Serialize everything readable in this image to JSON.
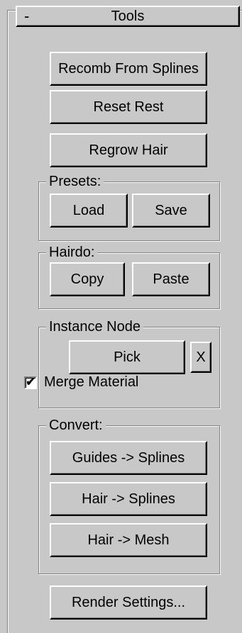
{
  "rollout": {
    "collapse_symbol": "-",
    "title": "Tools"
  },
  "buttons": {
    "recomb": "Recomb From Splines",
    "reset_rest": "Reset Rest",
    "regrow": "Regrow Hair",
    "render_settings": "Render Settings..."
  },
  "presets": {
    "label": "Presets:",
    "load": "Load",
    "save": "Save"
  },
  "hairdo": {
    "label": "Hairdo:",
    "copy": "Copy",
    "paste": "Paste"
  },
  "instance_node": {
    "label": "Instance Node",
    "pick": "Pick",
    "clear": "X",
    "merge_material_label": "Merge Material",
    "merge_material_checked": true,
    "check_mark": "✔"
  },
  "convert": {
    "label": "Convert:",
    "guides_to_splines": "Guides -> Splines",
    "hair_to_splines": "Hair -> Splines",
    "hair_to_mesh": "Hair -> Mesh"
  }
}
